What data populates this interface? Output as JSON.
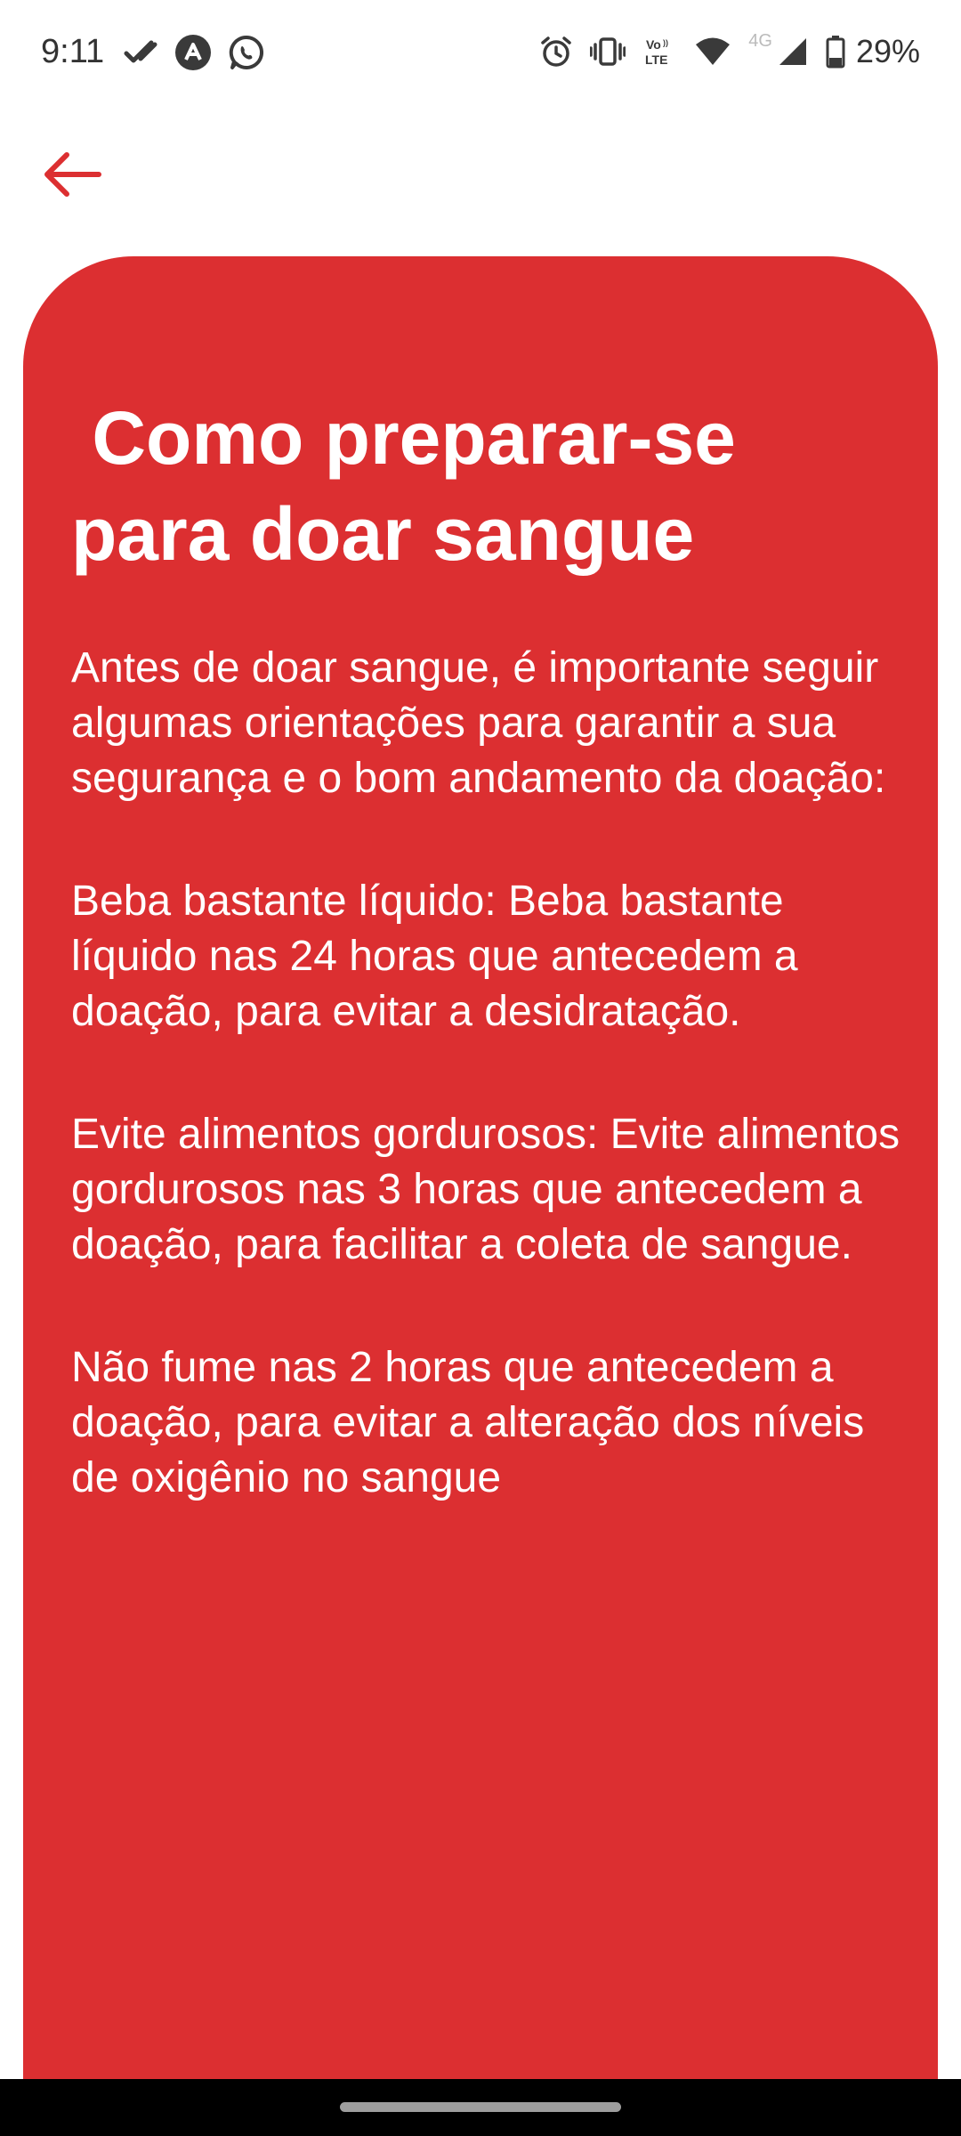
{
  "status_bar": {
    "time": "9:11",
    "battery": "29%",
    "network_badge": "4G",
    "left_icons": [
      "check-icon",
      "arrow-app-icon",
      "whatsapp-icon"
    ],
    "right_icons": [
      "alarm-icon",
      "vibrate-icon",
      "volte-icon",
      "wifi-icon",
      "signal-icon",
      "battery-icon"
    ]
  },
  "app_bar": {
    "back_icon": "arrow-left-icon",
    "accent_color": "#dc2f31"
  },
  "card": {
    "background_color": "#dc2f31",
    "title": " Como preparar-se para doar sangue",
    "paragraphs": [
      "Antes de doar sangue, é importante seguir algumas orientações para garantir a sua segurança e o bom andamento da doação:",
      "Beba bastante líquido: Beba bastante líquido nas 24 horas que antecedem a doação, para evitar a desidratação.",
      "Evite alimentos gordurosos: Evite alimentos gordurosos nas 3 horas que antecedem a doação, para facilitar a coleta de sangue.",
      "Não fume nas 2 horas que antecedem a doação, para evitar a alteração dos níveis de oxigênio no sangue"
    ]
  }
}
